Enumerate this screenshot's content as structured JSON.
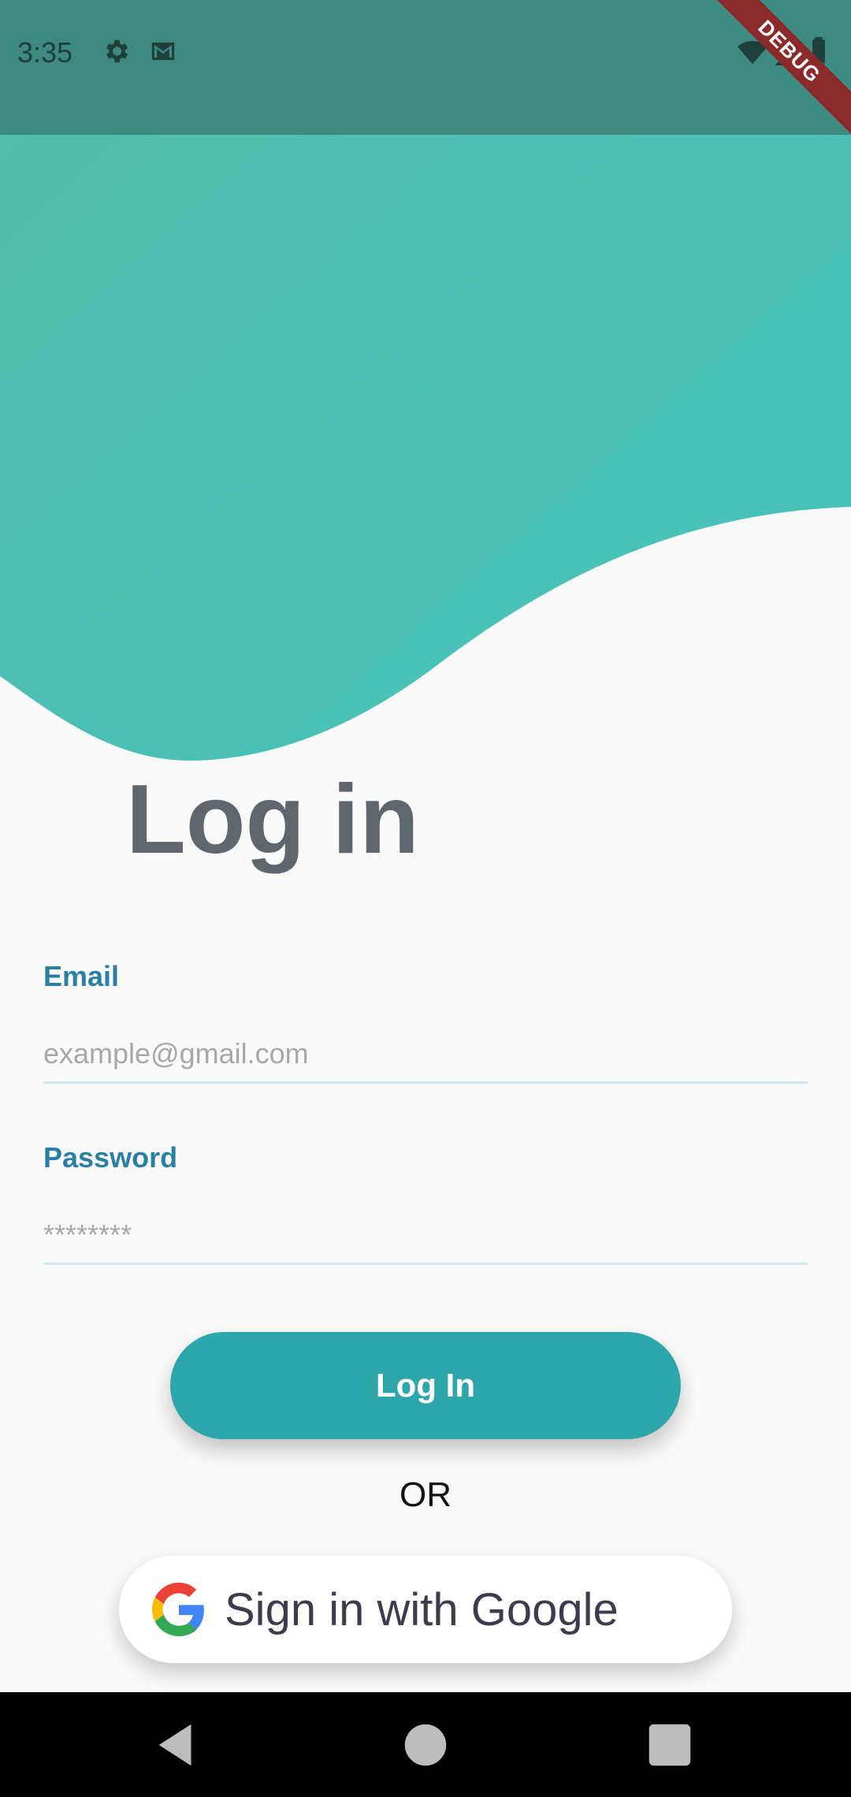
{
  "status_bar": {
    "time": "3:35",
    "icons": [
      "settings-icon",
      "gmail-icon",
      "wifi-icon",
      "signal-icon",
      "battery-icon"
    ],
    "debug_label": "DEBUG"
  },
  "header": {
    "gradient_start": "#55bcaa",
    "gradient_end": "#45c4bd"
  },
  "page": {
    "title": "Log in"
  },
  "form": {
    "email": {
      "label": "Email",
      "placeholder": "example@gmail.com",
      "value": ""
    },
    "password": {
      "label": "Password",
      "placeholder": "********",
      "value": ""
    }
  },
  "actions": {
    "login_label": "Log In",
    "separator": "OR",
    "google_label": "Sign in with Google"
  },
  "nav_bar": {
    "icons": [
      "back-icon",
      "home-icon",
      "recents-icon"
    ]
  },
  "colors": {
    "accent": "#2ca5ab",
    "label": "#2a7fa6",
    "title": "#5f676d"
  }
}
